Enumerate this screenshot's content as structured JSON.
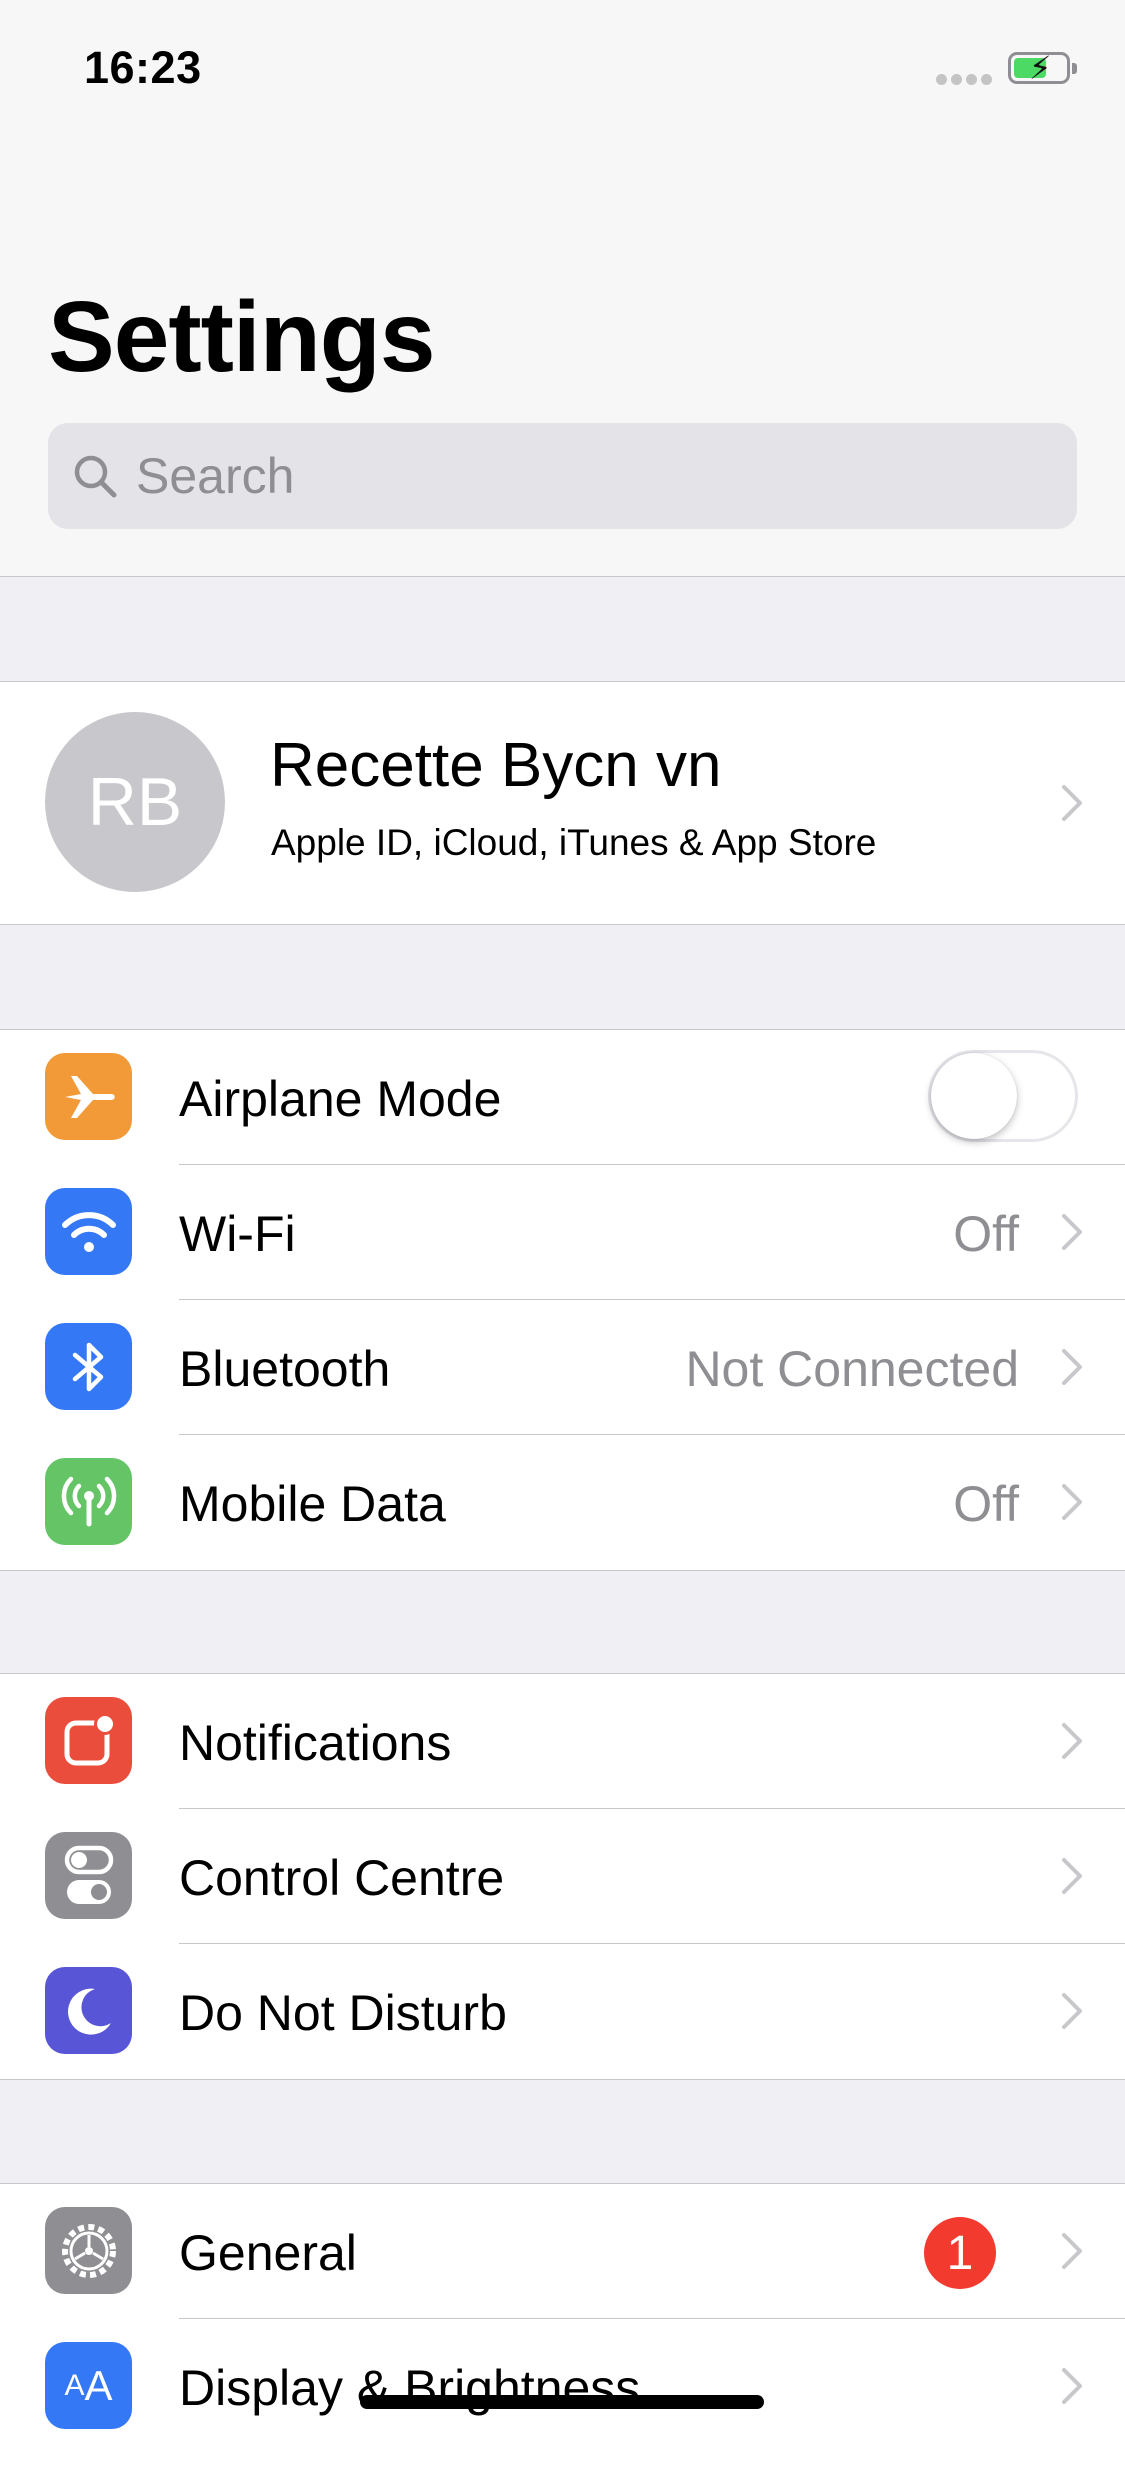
{
  "status_bar": {
    "time": "16:23",
    "battery": "charging"
  },
  "header": {
    "title": "Settings"
  },
  "search": {
    "placeholder": "Search"
  },
  "profile": {
    "initials": "RB",
    "name": "Recette Bycn vn",
    "subtitle": "Apple ID, iCloud, iTunes & App Store"
  },
  "connectivity": [
    {
      "label": "Airplane Mode",
      "icon": "airplane-icon",
      "color": "#f19a37",
      "toggle": false
    },
    {
      "label": "Wi-Fi",
      "icon": "wifi-icon",
      "color": "#3478f6",
      "value": "Off"
    },
    {
      "label": "Bluetooth",
      "icon": "bluetooth-icon",
      "color": "#3478f6",
      "value": "Not Connected"
    },
    {
      "label": "Mobile Data",
      "icon": "antenna-icon",
      "color": "#65c466",
      "value": "Off"
    }
  ],
  "system": [
    {
      "label": "Notifications",
      "icon": "notifications-icon",
      "color": "#eb4d3d"
    },
    {
      "label": "Control Centre",
      "icon": "control-centre-icon",
      "color": "#8e8e93"
    },
    {
      "label": "Do Not Disturb",
      "icon": "moon-icon",
      "color": "#5856d6"
    }
  ],
  "general": [
    {
      "label": "General",
      "icon": "gear-icon",
      "color": "#8e8e93",
      "badge": "1"
    },
    {
      "label": "Display & Brightness",
      "icon": "text-size-icon",
      "color": "#3478f6",
      "icon_text": "AA"
    }
  ]
}
